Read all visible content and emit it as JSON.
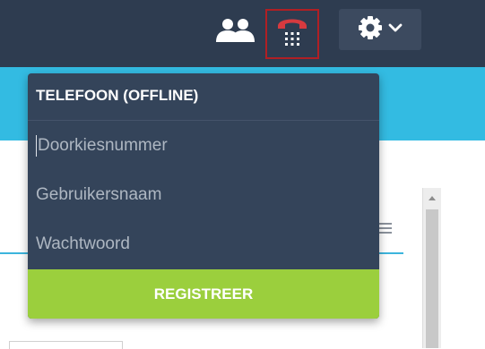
{
  "topbar": {
    "contacts_icon": "contacts-icon",
    "phone_icon": "phone-keypad-icon",
    "settings_icon": "gear-icon",
    "settings_chevron": "chevron-down-icon",
    "phone_color": "#d63a3f"
  },
  "phone_panel": {
    "title": "TELEFOON (OFFLINE)",
    "extension_placeholder": "Doorkiesnummer",
    "username_placeholder": "Gebruikersnaam",
    "password_placeholder": "Wachtwoord",
    "register_label": "REGISTREER",
    "register_color": "#9bcf3d"
  },
  "colors": {
    "topbar": "#2e3c50",
    "accent": "#33bbe2",
    "panel": "#34445a"
  }
}
